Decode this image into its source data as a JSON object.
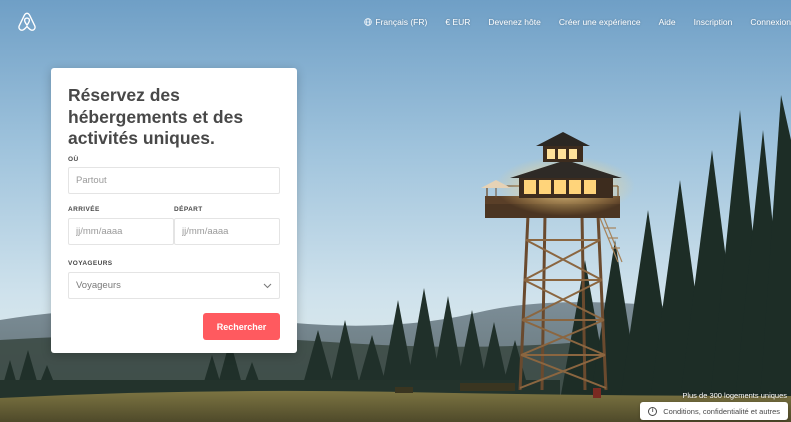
{
  "nav": {
    "logo": "airbnb-logo",
    "language": "Français (FR)",
    "currency": "€ EUR",
    "host": "Devenez hôte",
    "experience": "Créer une expérience",
    "help": "Aide",
    "signup": "Inscription",
    "login": "Connexion"
  },
  "card": {
    "title": "Réservez des hébergements et des activités uniques.",
    "where_label": "OÙ",
    "where_placeholder": "Partout",
    "checkin_label": "ARRIVÉE",
    "checkin_placeholder": "jj/mm/aaaa",
    "checkout_label": "DÉPART",
    "checkout_placeholder": "jj/mm/aaaa",
    "guests_label": "VOYAGEURS",
    "guests_value": "Voyageurs",
    "search_button": "Rechercher"
  },
  "footer": {
    "caption": "Plus de 300 logements uniques",
    "info_icon_text": "i",
    "legal": "Conditions, confidentialité et autres"
  },
  "colors": {
    "accent": "#ff5a5f",
    "text": "#484848"
  },
  "icons": {
    "logo": "airbnb-logo",
    "globe": "globe-icon",
    "chevron": "chevron-down-icon",
    "info": "info-icon"
  }
}
